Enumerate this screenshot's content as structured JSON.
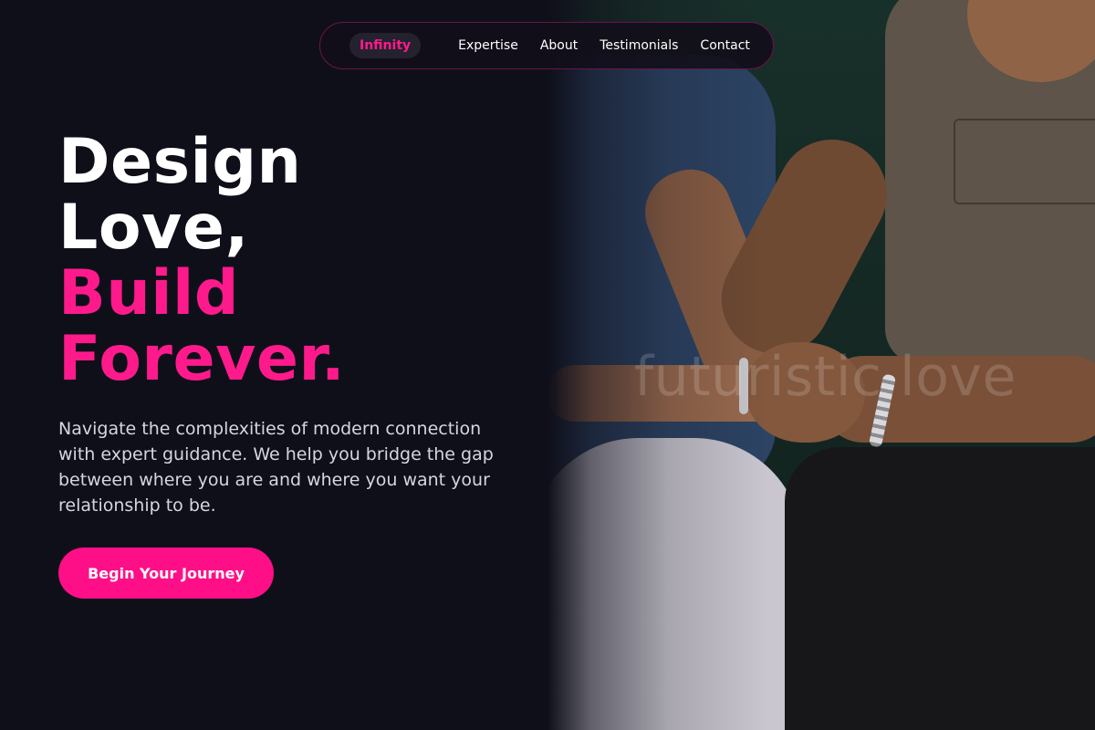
{
  "nav": {
    "brand": "Infinity",
    "links": [
      "Expertise",
      "About",
      "Testimonials",
      "Contact"
    ]
  },
  "hero": {
    "headline_line1": "Design",
    "headline_line2": "Love,",
    "headline_line3": "Build",
    "headline_line4": "Forever.",
    "subtitle": "Navigate the complexities of modern connection with expert guidance. We help you bridge the gap between where you are and where you want your relationship to be.",
    "cta_label": "Begin Your Journey",
    "image_watermark": "futuristic love"
  },
  "colors": {
    "background": "#0f0f1a",
    "accent": "#ff1a8c",
    "text": "#ffffff",
    "muted_text": "#d6d6de"
  }
}
